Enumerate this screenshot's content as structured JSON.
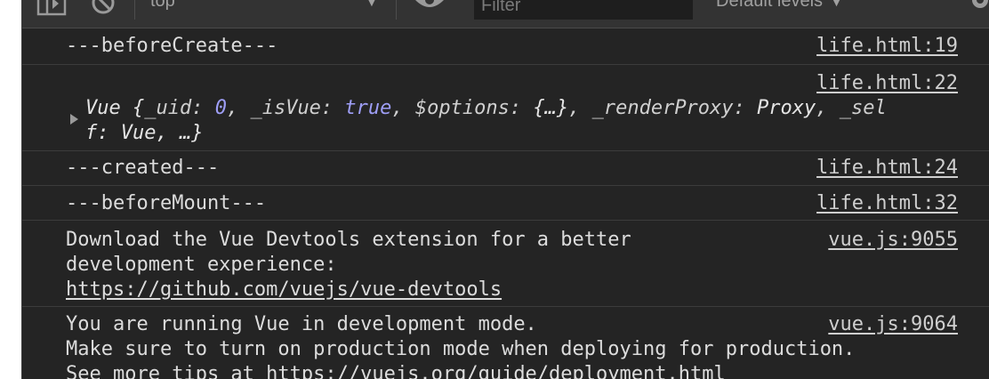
{
  "toolbar": {
    "context": "top",
    "filter_placeholder": "Filter",
    "levels": "Default levels ▼"
  },
  "logs": [
    {
      "message": "---beforeCreate---",
      "source": "life.html:19"
    },
    {
      "message_parts": {
        "lead": "Vue {",
        "k1": "_uid: ",
        "v1": "0",
        "k2": ", _isVue: ",
        "v2": "true",
        "k3": ", $options: ",
        "v3": "{…}",
        "k4": ", _renderProxy: ",
        "v4": "Proxy",
        "tail1": ", _sel",
        "line2": "f: Vue, …}"
      },
      "source": "life.html:22"
    },
    {
      "message": "---created---",
      "source": "life.html:24"
    },
    {
      "message": "---beforeMount---",
      "source": "life.html:32"
    },
    {
      "line1": "Download the Vue Devtools extension for a better",
      "line2": "development experience:",
      "link": "https://github.com/vuejs/vue-devtools",
      "source": "vue.js:9055"
    },
    {
      "line1": "You are running Vue in development mode.",
      "line2": "Make sure to turn on production mode when deploying for production.",
      "line3": "See more tips at https://vuejs.org/guide/deployment.html",
      "source": "vue.js:9064"
    }
  ]
}
